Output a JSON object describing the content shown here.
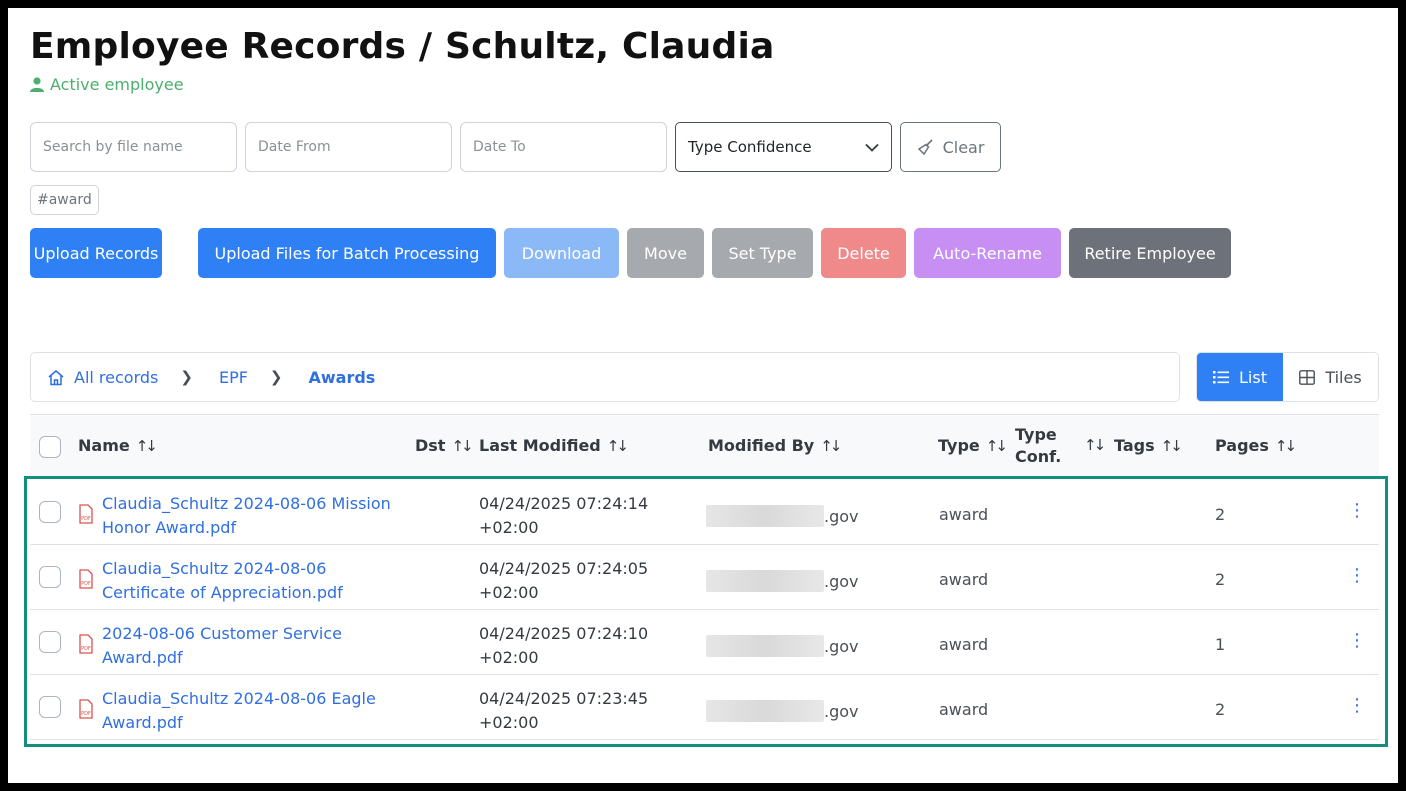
{
  "page": {
    "title": "Employee Records / Schultz, Claudia",
    "status": "Active employee"
  },
  "filters": {
    "search_placeholder": "Search by file name",
    "date_from_placeholder": "Date From",
    "date_to_placeholder": "Date To",
    "type_confidence": "Type Confidence",
    "clear_label": "Clear",
    "active_tag": "#award"
  },
  "actions": {
    "upload_records": "Upload Records",
    "upload_batch": "Upload Files for Batch Processing",
    "download": "Download",
    "move": "Move",
    "set_type": "Set Type",
    "delete": "Delete",
    "auto_rename": "Auto-Rename",
    "retire_employee": "Retire Employee"
  },
  "breadcrumb": {
    "items": [
      "All records",
      "EPF",
      "Awards"
    ]
  },
  "view": {
    "list_label": "List",
    "tiles_label": "Tiles",
    "active": "List"
  },
  "table": {
    "columns": [
      "Name",
      "Dst",
      "Last Modified",
      "Modified By",
      "Type",
      "Type Conf.",
      "Tags",
      "Pages"
    ],
    "rows": [
      {
        "name": "Claudia_Schultz 2024-08-06 Mission Honor Award.pdf",
        "date": "04/24/2025 07:24:14",
        "tz": "+02:00",
        "modified_by": ".gov",
        "type": "award",
        "pages": "2"
      },
      {
        "name": "Claudia_Schultz 2024-08-06 Certificate of Appreciation.pdf",
        "date": "04/24/2025 07:24:05",
        "tz": "+02:00",
        "modified_by": ".gov",
        "type": "award",
        "pages": "2"
      },
      {
        "name": "2024-08-06 Customer Service Award.pdf",
        "date": "04/24/2025 07:24:10",
        "tz": "+02:00",
        "modified_by": ".gov",
        "type": "award",
        "pages": "1"
      },
      {
        "name": "Claudia_Schultz 2024-08-06 Eagle Award.pdf",
        "date": "04/24/2025 07:23:45",
        "tz": "+02:00",
        "modified_by": ".gov",
        "type": "award",
        "pages": "2"
      }
    ]
  },
  "colors": {
    "primary": "#2f7ff5",
    "download": "#8bb9f8",
    "move": "#a6a9ad",
    "set_type": "#a6a9ad",
    "delete": "#f08a8a",
    "auto_rename": "#c78ef4",
    "retire": "#6c717a",
    "highlight": "#148f7e",
    "status_green": "#4caf6e"
  }
}
